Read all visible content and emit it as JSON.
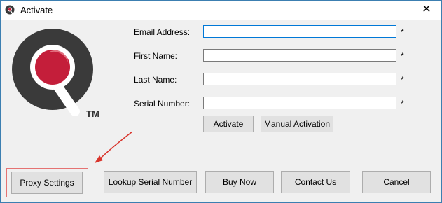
{
  "window": {
    "title": "Activate",
    "close_glyph": "✕",
    "logo_text": "TM"
  },
  "form": {
    "email_label": "Email Address:",
    "first_name_label": "First Name:",
    "last_name_label": "Last Name:",
    "serial_label": "Serial Number:",
    "email_value": "",
    "first_name_value": "",
    "last_name_value": "",
    "serial_value": "",
    "required_mark": "*"
  },
  "buttons": {
    "activate": "Activate",
    "manual_activation": "Manual Activation",
    "proxy_settings": "Proxy Settings",
    "lookup_serial": "Lookup Serial Number",
    "buy_now": "Buy Now",
    "contact_us": "Contact Us",
    "cancel": "Cancel"
  },
  "colors": {
    "accent": "#0078d7",
    "logo_dark": "#3a3a3a",
    "logo_red": "#c41e3a",
    "annotation_red": "#d9342b"
  }
}
